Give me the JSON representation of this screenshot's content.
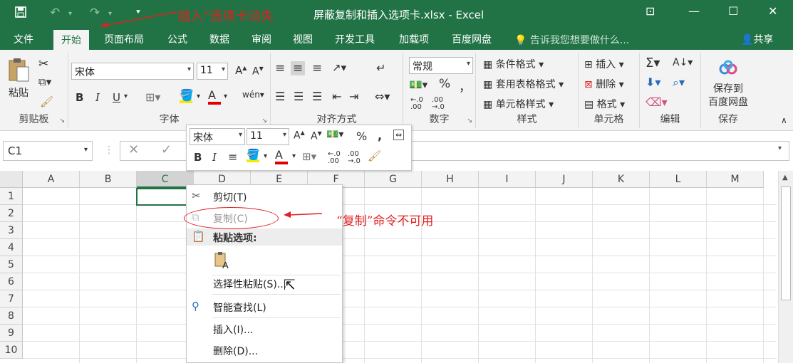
{
  "titlebar": {
    "title": "屏蔽复制和插入选项卡.xlsx - Excel",
    "annotation": "“插入”选项卡消失",
    "save_icon": "save-icon",
    "undo_icon": "undo-icon",
    "redo_icon": "redo-icon"
  },
  "tabs": {
    "file": "文件",
    "home": "开始",
    "layout": "页面布局",
    "formulas": "公式",
    "data": "数据",
    "review": "审阅",
    "view": "视图",
    "developer": "开发工具",
    "addins": "加载项",
    "baidu": "百度网盘",
    "tellme": "告诉我您想要做什么...",
    "share": "共享"
  },
  "ribbon": {
    "clipboard": {
      "paste": "粘贴",
      "label": "剪贴板"
    },
    "font": {
      "name": "宋体",
      "size": "11",
      "bold": "B",
      "italic": "I",
      "underline": "U",
      "label": "字体"
    },
    "alignment": {
      "label": "对齐方式"
    },
    "number": {
      "format": "常规",
      "percent": "%",
      "comma": "，",
      "label": "数字"
    },
    "styles": {
      "cond": "条件格式",
      "table": "套用表格格式",
      "cell": "单元格样式",
      "label": "样式"
    },
    "cells": {
      "insert": "插入",
      "delete": "删除",
      "format": "格式",
      "label": "单元格"
    },
    "editing": {
      "label": "编辑"
    },
    "save": {
      "line1": "保存到",
      "line2": "百度网盘",
      "label": "保存"
    }
  },
  "formula": {
    "namebox": "C1",
    "value": ""
  },
  "columns": [
    "A",
    "B",
    "C",
    "D",
    "E",
    "F",
    "G",
    "H",
    "I",
    "J",
    "K",
    "L",
    "M"
  ],
  "rows": [
    "1",
    "2",
    "3",
    "4",
    "5",
    "6",
    "7",
    "8",
    "9",
    "10"
  ],
  "minitoolbar": {
    "font": "宋体",
    "size": "11",
    "percent": "%",
    "comma": ",",
    "bold": "B",
    "italic": "I",
    "align": "≡"
  },
  "context_menu": {
    "cut": "剪切(T)",
    "copy": "复制(C)",
    "paste_options": "粘贴选项:",
    "paste_special": "选择性粘贴(S)...",
    "smart_lookup": "智能查找(L)",
    "insert": "插入(I)...",
    "delete": "删除(D)..."
  },
  "annotation_copy": "“复制”命令不可用",
  "colors": {
    "excel_green": "#217346",
    "annotation_red": "#e02020"
  }
}
